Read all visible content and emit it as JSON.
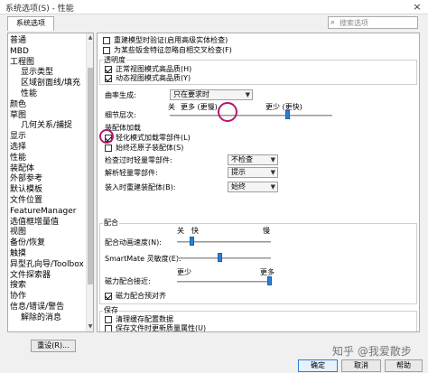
{
  "window": {
    "title": "系统选项(S) - 性能",
    "close_glyph": "×"
  },
  "tab": {
    "label": "系统选项"
  },
  "search": {
    "placeholder": "搜索选项",
    "icon": "search-icon"
  },
  "nav": {
    "items": [
      {
        "label": "普通",
        "indent": false
      },
      {
        "label": "MBD",
        "indent": false
      },
      {
        "label": "工程图",
        "indent": false
      },
      {
        "label": "显示类型",
        "indent": true
      },
      {
        "label": "区域剖面线/填充",
        "indent": true
      },
      {
        "label": "性能",
        "indent": true
      },
      {
        "label": "颜色",
        "indent": false
      },
      {
        "label": "草图",
        "indent": false
      },
      {
        "label": "几何关系/捕捉",
        "indent": true
      },
      {
        "label": "显示",
        "indent": false
      },
      {
        "label": "选择",
        "indent": false
      },
      {
        "label": "性能",
        "indent": false
      },
      {
        "label": "装配体",
        "indent": false
      },
      {
        "label": "外部参考",
        "indent": false
      },
      {
        "label": "默认模板",
        "indent": false
      },
      {
        "label": "文件位置",
        "indent": false
      },
      {
        "label": "FeatureManager",
        "indent": false
      },
      {
        "label": "选值框增量值",
        "indent": false
      },
      {
        "label": "视图",
        "indent": false
      },
      {
        "label": "备份/恢复",
        "indent": false
      },
      {
        "label": "触摸",
        "indent": false
      },
      {
        "label": "异型孔向导/Toolbox",
        "indent": false
      },
      {
        "label": "文件探索器",
        "indent": false
      },
      {
        "label": "搜索",
        "indent": false
      },
      {
        "label": "协作",
        "indent": false
      },
      {
        "label": "信息/错误/警告",
        "indent": false
      },
      {
        "label": "解除的消息",
        "indent": true
      }
    ],
    "reset_label": "重设(R)..."
  },
  "perf": {
    "rebuild_check": "重建模型时验证(启用高级实体检查)",
    "sheetmetal_check": "为某些钣金特征忽略自相交叉检查(F)",
    "transparency": {
      "title": "透明度",
      "normal_label": "正常视图模式高品质(H)",
      "dynamic_label": "动态视图模式高品质(Y)"
    },
    "curvature": {
      "label": "曲率生成:",
      "value": "只在要求时"
    },
    "detail": {
      "label": "细节层次:",
      "off_label": "关",
      "more_label": "更多 (更慢)",
      "less_label": "更少 (更快)",
      "level": 0.72
    },
    "assembly_load": {
      "title": "装配体加载",
      "lightweight_label": "轻化模式加载零部件(L)",
      "restore_label": "始终还原子装配体(S)",
      "check_label": "检查过时轻量零部件:",
      "check_value": "不检查",
      "resolve_label": "解析轻量零部件:",
      "resolve_value": "提示",
      "rebuild_label": "装入时重建装配体(B):",
      "rebuild_value": "始终"
    },
    "mates": {
      "title": "配合",
      "off_label": "关",
      "fast_label": "快",
      "slow_label": "慢",
      "speed_label": "配合动画速度(N):",
      "speed_level": 0.15,
      "smartmate_label": "SmartMate 灵敏度(E):",
      "smartmate_level": 0.45,
      "proximity_less": "更少",
      "proximity_more": "更多",
      "proximity_label": "磁力配合接近:",
      "proximity_level": 0.98,
      "magnetic_label": "磁力配合预对齐"
    },
    "save": {
      "title": "保存",
      "clear_cache_label": "清理缓存配置数据",
      "update_mass_label": "保存文件时更新质量属性(U)"
    }
  },
  "buttons": {
    "ok": "确定",
    "cancel": "取消",
    "help": "帮助"
  },
  "watermark": "知乎 @我爱散步",
  "colors": {
    "accent": "#2a7fd8",
    "highlight": "#b41a6a"
  }
}
